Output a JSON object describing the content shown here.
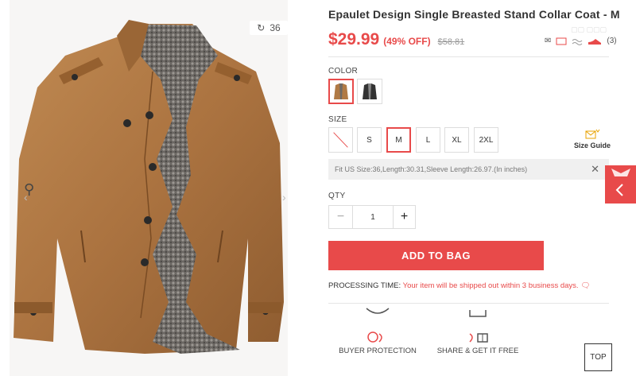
{
  "gallery": {
    "counter": "36",
    "counter_icon": "rotate-icon",
    "zoom_icon": "zoom-icon"
  },
  "product": {
    "title": "Epaulet Design Single Breasted Stand Collar Coat - M",
    "price": "$29.99",
    "discount": "(49% OFF)",
    "original_price": "$58.81",
    "faint_text": "▢▢ ▢▢▢",
    "share_count": "(3)",
    "share_icons": [
      "envelope-icon",
      "bookmark-icon",
      "wave-icon",
      "shoe-icon"
    ]
  },
  "color": {
    "label": "COLOR",
    "options": [
      "brown",
      "black"
    ],
    "selected": "brown"
  },
  "size": {
    "label": "SIZE",
    "options": [
      "S",
      "M",
      "L",
      "XL",
      "2XL"
    ],
    "selected": "M",
    "guide_label": "Size Guide",
    "fit_text": "Fit US Size:36,Length:30.31,Sleeve Length:26.97.(In inches)",
    "close_symbol": "✕"
  },
  "qty": {
    "label": "QTY",
    "value": "1",
    "minus": "−",
    "plus": "+"
  },
  "actions": {
    "add_to_bag": "ADD TO BAG"
  },
  "processing": {
    "label": "PROCESSING TIME:",
    "message": "Your item will be shipped out within 3 business days."
  },
  "features": {
    "buyer_protection": "BUYER PROTECTION",
    "share": "SHARE & GET IT FREE"
  },
  "nav": {
    "top": "TOP"
  },
  "colors": {
    "accent": "#e84a4a",
    "coat": "#b07a45",
    "fur": "#6e6a66"
  }
}
